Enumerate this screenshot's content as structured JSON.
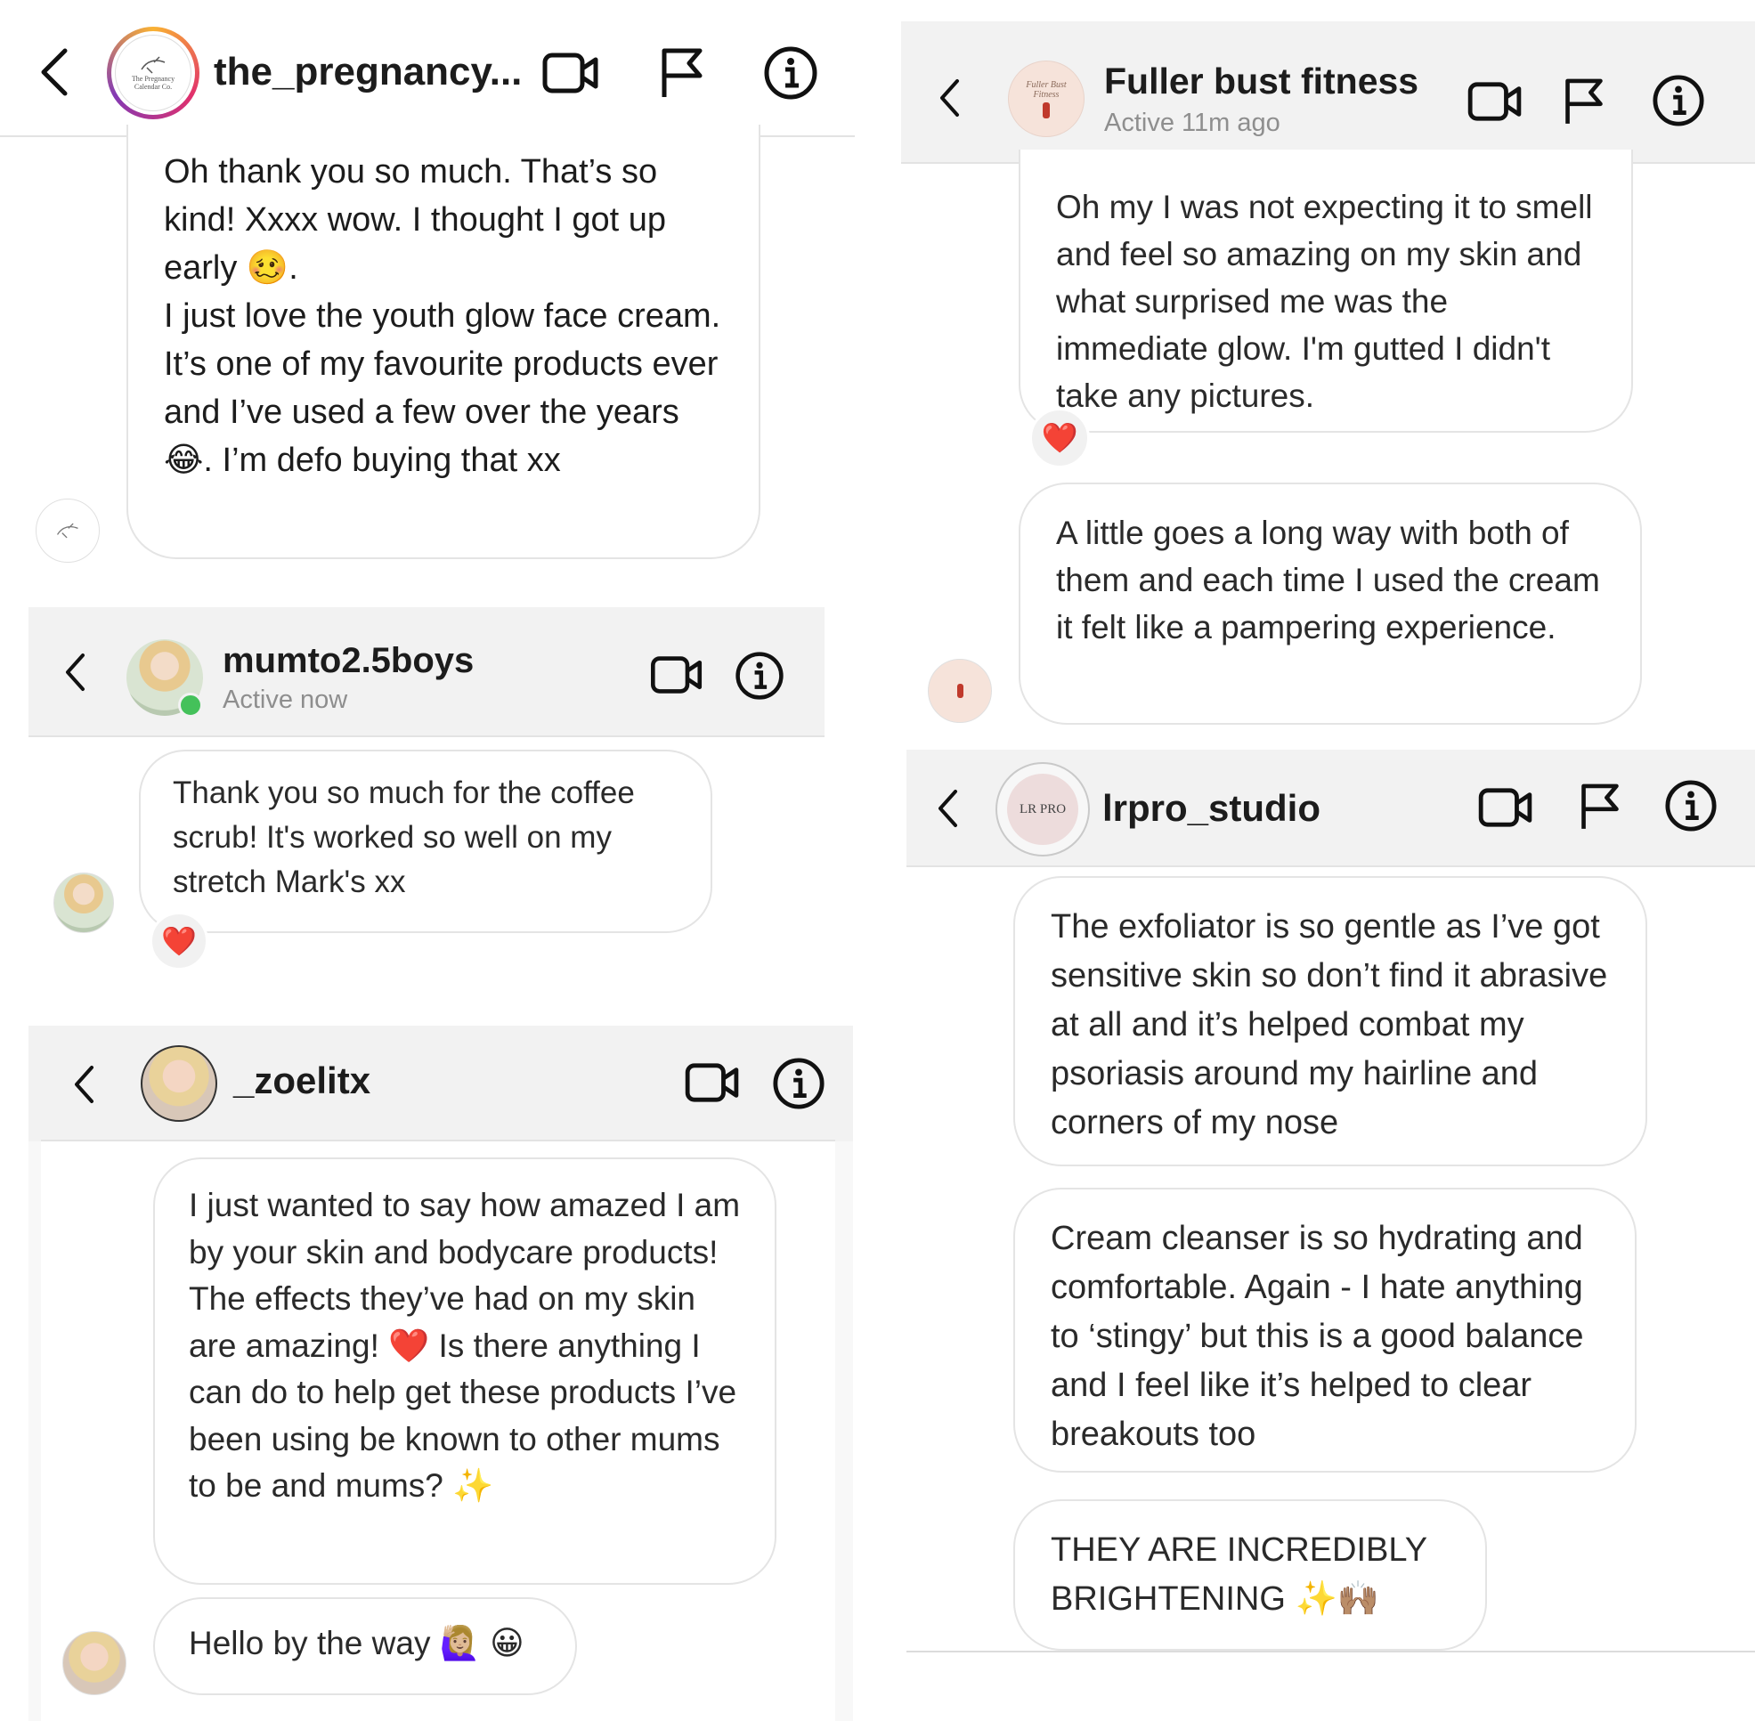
{
  "panels": {
    "pregnancy": {
      "handle": "the_pregnancy...",
      "avatar_text": "The Pregnancy Calendar Co.",
      "message": "Oh thank you so much. That’s so kind! Xxxx wow. I thought I got up early 🥴.\nI just love the youth glow face cream. It’s one of my favourite products ever and I’ve used a few over the years 😂. I’m defo buying that xx"
    },
    "mumto": {
      "handle": "mumto2.5boys",
      "status": "Active now",
      "message": "Thank you so much for the coffee scrub! It's worked so well on my stretch Mark's xx",
      "reaction": "❤️"
    },
    "zoelitx": {
      "handle": "_zoelitx",
      "message1": "I just wanted to say how amazed I am by your skin and bodycare products! The effects they’ve had on my skin are amazing! ❤️ Is there anything I can do to help get these products I’ve been using be known to other mums to be and mums? ✨",
      "message2": "Hello by the way 🙋🏼‍♀️ 😀"
    },
    "fuller": {
      "handle": "Fuller bust fitness",
      "status": "Active 11m ago",
      "avatar_text": "Fuller Bust Fitness",
      "message1": "Oh my I was not expecting it to smell and feel so amazing on my skin and what surprised me was the immediate glow. I'm gutted I didn't take any pictures.",
      "reaction": "❤️",
      "message2": "A little goes a long way with both of them and each time I used the cream it felt like a pampering experience."
    },
    "lrpro": {
      "handle": "lrpro_studio",
      "avatar_text": "LR PRO",
      "message1": "The exfoliator is so gentle as I’ve got sensitive skin so don’t find it abrasive at all and it’s helped combat my psoriasis around my hairline and corners of my nose",
      "message2": "Cream cleanser is so hydrating and comfortable. Again - I hate anything to ‘stingy’ but this is a good balance and I feel like it’s helped to clear breakouts too",
      "message3": "THEY ARE INCREDIBLY BRIGHTENING ✨🙌🏽"
    }
  },
  "icons": {
    "back": "chevron-left-icon",
    "video": "video-camera-icon",
    "flag": "flag-icon",
    "info": "info-icon"
  },
  "colors": {
    "online": "#44c15a",
    "bubble_border": "#e4e4e4",
    "header_bg": "#f2f2f2",
    "story_ring": [
      "#f9b233",
      "#e1306c",
      "#833ab4"
    ]
  }
}
